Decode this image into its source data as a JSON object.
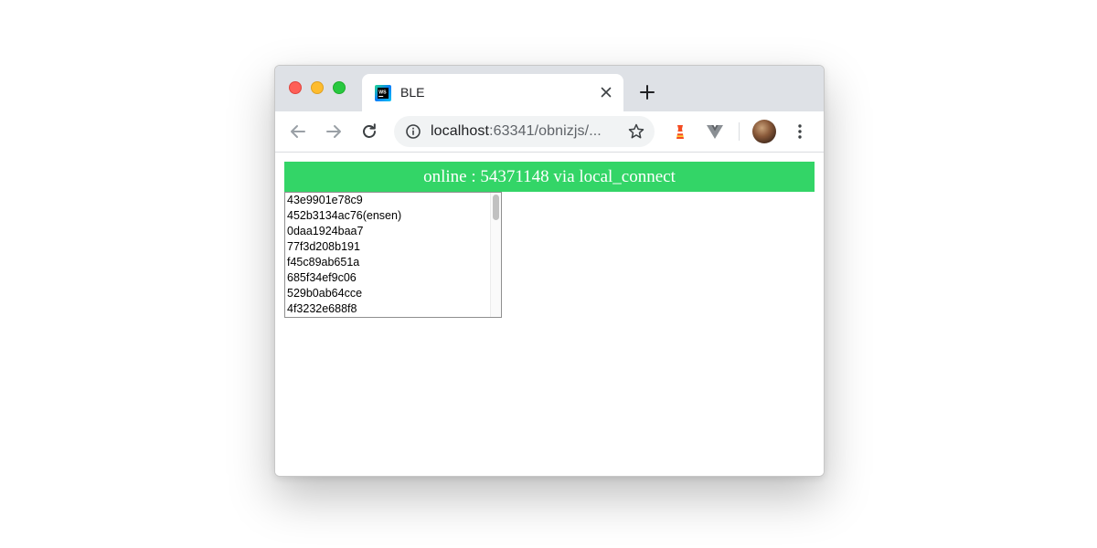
{
  "browser": {
    "tab_title": "BLE",
    "url_host": "localhost",
    "url_rest": ":63341/obnizjs/...",
    "favicon": "webstorm-icon"
  },
  "page": {
    "status_text": "online : 54371148 via local_connect",
    "devices": [
      "43e9901e78c9",
      "452b3134ac76(ensen)",
      "0daa1924baa7",
      "77f3d208b191",
      "f45c89ab651a",
      "685f34ef9c06",
      "529b0ab64cce",
      "4f3232e688f8"
    ]
  },
  "colors": {
    "status_bg": "#33d567",
    "tabstrip_bg": "#dee1e6"
  }
}
